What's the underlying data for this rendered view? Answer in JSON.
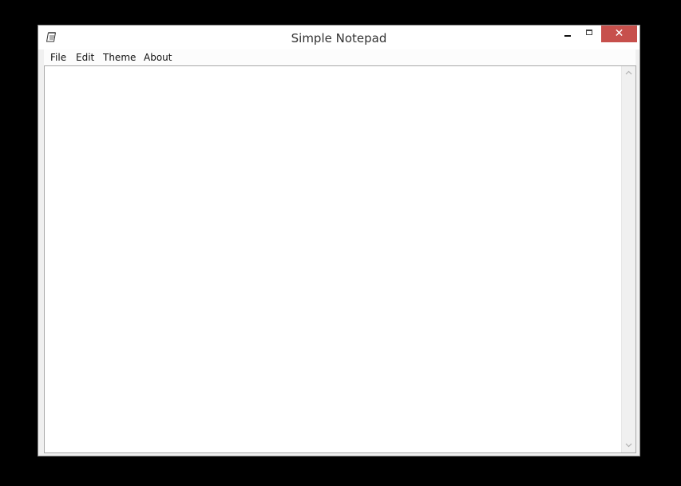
{
  "window": {
    "title": "Simple Notepad",
    "close_label": "✕"
  },
  "menubar": {
    "items": [
      {
        "label": "File"
      },
      {
        "label": "Edit"
      },
      {
        "label": "Theme"
      },
      {
        "label": "About"
      }
    ]
  },
  "editor": {
    "content": ""
  },
  "colors": {
    "close_button": "#c7504c",
    "desktop_background": "#000000"
  },
  "icons": {
    "app": "notepad-icon",
    "minimize": "minimize-icon",
    "maximize": "maximize-icon",
    "close": "close-icon",
    "scroll_up": "chevron-up-icon",
    "scroll_down": "chevron-down-icon"
  }
}
